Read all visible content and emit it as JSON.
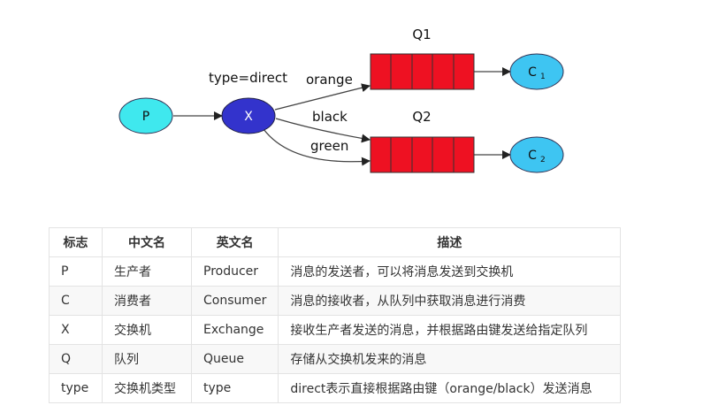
{
  "diagram": {
    "exchange_type_label": "type=direct",
    "producer": "P",
    "exchange": "X",
    "queues": [
      {
        "name": "Q1",
        "consumer_main": "C",
        "consumer_sub": "1",
        "bindings": [
          "orange"
        ]
      },
      {
        "name": "Q2",
        "consumer_main": "C",
        "consumer_sub": "2",
        "bindings": [
          "black",
          "green"
        ]
      }
    ],
    "colors": {
      "producer": "#3fe8ee",
      "exchange": "#3333cc",
      "queue_cell": "#ee1122",
      "consumer": "#3ec5f2"
    }
  },
  "table": {
    "headers": [
      "标志",
      "中文名",
      "英文名",
      "描述"
    ],
    "rows": [
      [
        "P",
        "生产者",
        "Producer",
        "消息的发送者，可以将消息发送到交换机"
      ],
      [
        "C",
        "消费者",
        "Consumer",
        "消息的接收者，从队列中获取消息进行消费"
      ],
      [
        "X",
        "交换机",
        "Exchange",
        "接收生产者发送的消息，并根据路由键发送给指定队列"
      ],
      [
        "Q",
        "队列",
        "Queue",
        "存储从交换机发来的消息"
      ],
      [
        "type",
        "交换机类型",
        "type",
        "direct表示直接根据路由键（orange/black）发送消息"
      ]
    ]
  }
}
